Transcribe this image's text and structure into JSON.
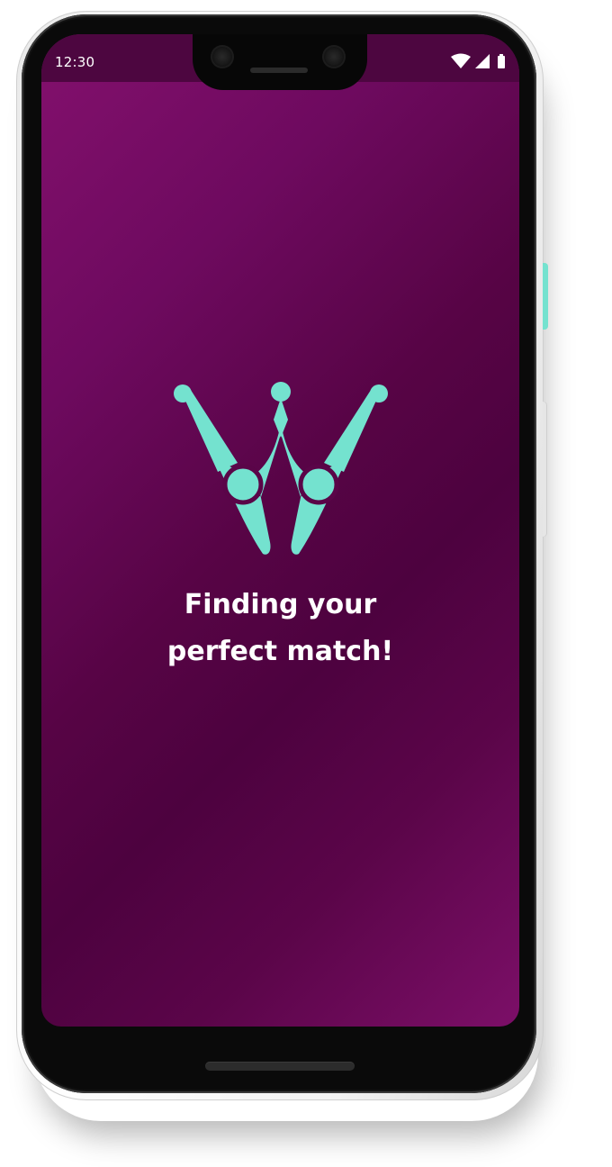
{
  "status_bar": {
    "time": "12:30",
    "icons": [
      "wifi-icon",
      "cellular-signal-icon",
      "battery-icon"
    ]
  },
  "splash": {
    "logo": "app-logo-crown-icon",
    "tagline_line1": "Finding your",
    "tagline_line2": "perfect match!"
  },
  "colors": {
    "background_gradient": [
      "#83106d",
      "#4d023f",
      "#7c0f68"
    ],
    "status_bar": "#4d0640",
    "accent": "#74e2cf",
    "text": "#ffffff"
  }
}
